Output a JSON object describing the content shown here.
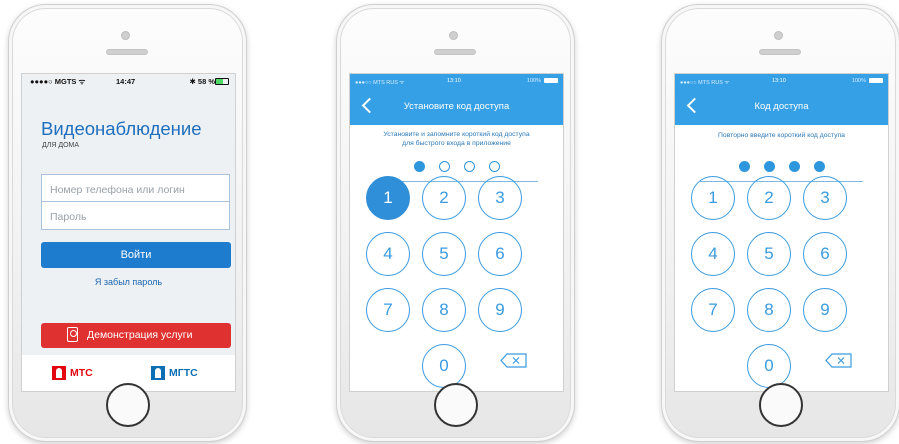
{
  "phone1": {
    "status": {
      "carrier": "●●●●○ MGTS ᯤ",
      "time": "14:47",
      "battery": "✱ 58 %",
      "battery_level": 0.58
    },
    "title": "Видеонаблюдение",
    "subtitle": "ДЛЯ ДОМА",
    "login_placeholder": "Номер телефона или логин",
    "password_placeholder": "Пароль",
    "login_button": "Войти",
    "forgot_link": "Я забыл пароль",
    "demo_button": "Демонстрация услуги",
    "brands": [
      {
        "name": "МТС",
        "color": "#e30611"
      },
      {
        "name": "МГТС",
        "color": "#0a6fb5"
      }
    ]
  },
  "phone2": {
    "status": {
      "carrier": "●●●○○ MTS RUS ᯤ",
      "time": "13:10",
      "battery": "100%"
    },
    "title": "Установите код доступа",
    "subtitle_line1": "Установите и запомните короткий код доступа",
    "subtitle_line2": "для быстрого входа в приложение",
    "filled_dots": 1,
    "keys": [
      "1",
      "2",
      "3",
      "4",
      "5",
      "6",
      "7",
      "8",
      "9",
      "0"
    ],
    "active_key": "1"
  },
  "phone3": {
    "status": {
      "carrier": "●●●○○ MTS RUS ᯤ",
      "time": "13:10",
      "battery": "100%"
    },
    "title": "Код доступа",
    "subtitle_line1": "Повторно введите короткий код доступа",
    "filled_dots": 4,
    "keys": [
      "1",
      "2",
      "3",
      "4",
      "5",
      "6",
      "7",
      "8",
      "9",
      "0"
    ]
  },
  "colors": {
    "accent": "#36a0e6",
    "login_button": "#1e7ccf",
    "demo_button": "#e03131"
  }
}
